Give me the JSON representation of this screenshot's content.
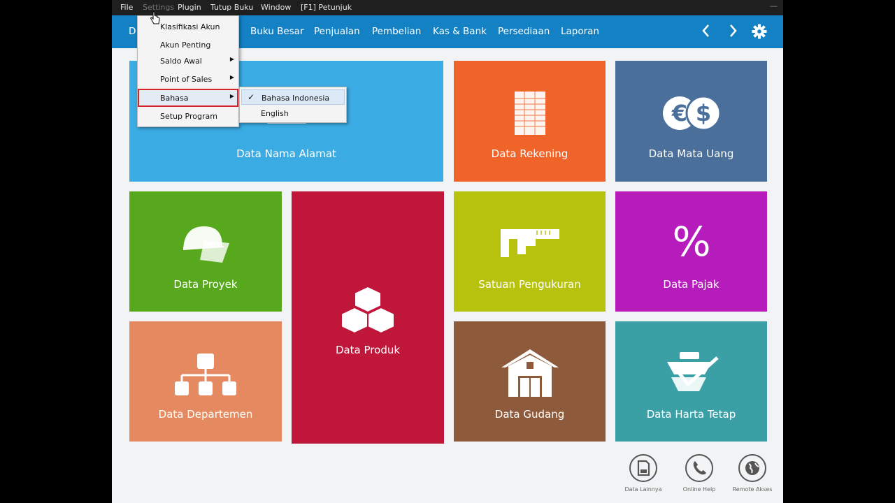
{
  "menubar": {
    "items": [
      "File",
      "Settings",
      "Plugin",
      "Tutup Buku",
      "Window",
      "[F1] Petunjuk"
    ]
  },
  "navbar": {
    "partial_label": "D",
    "items": [
      "Buku Besar",
      "Penjualan",
      "Pembelian",
      "Kas & Bank",
      "Persediaan",
      "Laporan"
    ],
    "prev_icon": "chevron-left-icon",
    "next_icon": "chevron-right-icon",
    "settings_icon": "gear-icon"
  },
  "settings_menu": {
    "items": [
      {
        "label": "Klasifikasi Akun",
        "submenu": false
      },
      {
        "label": "Akun Penting",
        "submenu": false
      },
      {
        "label": "Saldo Awal",
        "submenu": true
      },
      {
        "label": "Point of Sales",
        "submenu": true
      },
      {
        "label": "Bahasa",
        "submenu": true,
        "highlighted": true
      },
      {
        "label": "Setup Program",
        "submenu": false
      }
    ]
  },
  "language_submenu": {
    "items": [
      {
        "label": "Bahasa Indonesia",
        "checked": true
      },
      {
        "label": "English",
        "checked": false
      }
    ]
  },
  "tiles": [
    {
      "label": "Data Nama Alamat",
      "color": "#3aace3",
      "icon": "address-card-icon"
    },
    {
      "label": "Data Rekening",
      "color": "#f0642a",
      "icon": "ledger-book-icon"
    },
    {
      "label": "Data Mata Uang",
      "color": "#4a6f9a",
      "icon": "currency-icon"
    },
    {
      "label": "Data Proyek",
      "color": "#58a81e",
      "icon": "hardhat-icon"
    },
    {
      "label": "Data Produk",
      "color": "#c0163a",
      "icon": "boxes-icon"
    },
    {
      "label": "Satuan Pengukuran",
      "color": "#b7c20e",
      "icon": "caliper-icon"
    },
    {
      "label": "Data Pajak",
      "color": "#b51cbb",
      "icon": "percent-icon"
    },
    {
      "label": "Data Departemen",
      "color": "#e58a60",
      "icon": "org-chart-icon"
    },
    {
      "label": "Data Gudang",
      "color": "#8d5a3c",
      "icon": "warehouse-icon"
    },
    {
      "label": "Data Harta Tetap",
      "color": "#3ba0a5",
      "icon": "fixed-asset-icon"
    }
  ],
  "quick_actions": [
    {
      "label": "Data Lainnya",
      "icon": "sd-card-icon"
    },
    {
      "label": "Online Help",
      "icon": "phone-icon"
    },
    {
      "label": "Remote Akses",
      "icon": "globe-icon"
    }
  ],
  "colors": {
    "menubar_bg": "#1f1f1f",
    "navbar_bg": "#1381c4",
    "page_bg": "#f1f3f4",
    "highlight_border": "#d9252a"
  }
}
